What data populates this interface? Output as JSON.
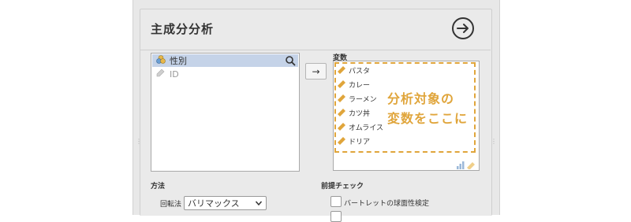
{
  "header": {
    "title": "主成分分析",
    "go_icon": "arrow-circle-right-icon"
  },
  "source_list": {
    "items": [
      {
        "label": "性別",
        "icon": "nominal-variable-icon",
        "selected": true
      },
      {
        "label": "ID",
        "icon": "id-variable-icon",
        "selected": false
      }
    ],
    "search_icon": "search-icon"
  },
  "move_button": {
    "label": "→"
  },
  "variables": {
    "label": "変数",
    "items": [
      "パスタ",
      "カレー",
      "ラーメン",
      "カツ丼",
      "オムライス",
      "ドリア"
    ],
    "hint_line1": "分析対象の",
    "hint_line2": "変数をここに",
    "accent_color": "#e0a53b"
  },
  "method": {
    "label": "方法",
    "rotation_label": "回転法",
    "rotation_value": "バリマックス"
  },
  "assumption_checks": {
    "label": "前提チェック",
    "items": [
      {
        "label": "バートレットの球面性検定",
        "checked": false
      }
    ]
  }
}
